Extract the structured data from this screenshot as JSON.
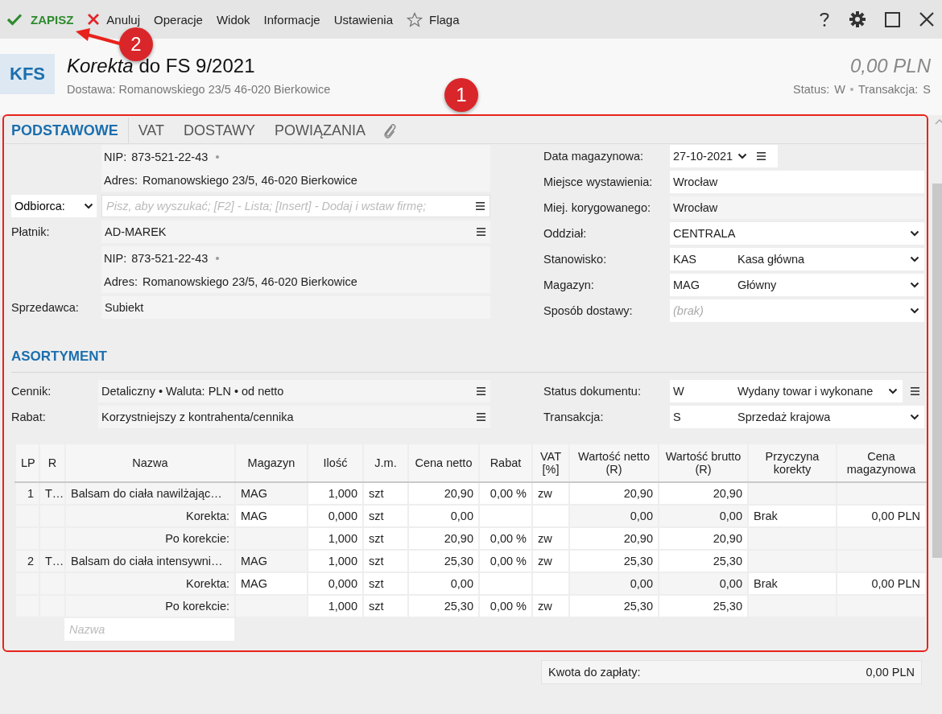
{
  "toolbar": {
    "items": [
      {
        "kind": "save",
        "label": "ZAPISZ"
      },
      {
        "kind": "cancel",
        "label": "Anuluj"
      },
      {
        "kind": "menu",
        "label": "Operacje"
      },
      {
        "kind": "menu",
        "label": "Widok"
      },
      {
        "kind": "menu",
        "label": "Informacje"
      },
      {
        "kind": "menu",
        "label": "Ustawienia"
      },
      {
        "kind": "flag",
        "label": "Flaga"
      }
    ]
  },
  "header": {
    "badge": "KFS",
    "title": "*Korekta* do FS 9/2021",
    "subtitle": "Dostawa: Romanowskiego 23/5 46-020 Bierkowice",
    "amount": "0,00 PLN",
    "status_label": "Status:",
    "status_value": "W",
    "transaction_label": "Transakcja:",
    "transaction_value": "S"
  },
  "tabs": [
    {
      "label": "PODSTAWOWE",
      "selected": true
    },
    {
      "label": "VAT",
      "selected": false
    },
    {
      "label": "DOSTAWY",
      "selected": false
    },
    {
      "label": "POWIĄZANIA",
      "selected": false
    }
  ],
  "left_form": [
    {
      "kind": "info",
      "lines": [
        {
          "label": "NIP:",
          "value": "873-521-22-43",
          "marker": true
        },
        {
          "label": "Adres:",
          "value": "Romanowskiego 23/5, 46-020 Bierkowice",
          "marker": false
        }
      ]
    },
    {
      "kind": "search",
      "label": "Odbiorca:",
      "placeholder": "Pisz, aby wyszukać; [F2] - Lista; [Insert] - Dodaj i wstaw firmę;"
    },
    {
      "kind": "field",
      "label": "Płatnik:",
      "value": "AD-MAREK",
      "menu": true
    },
    {
      "kind": "info",
      "lines": [
        {
          "label": "NIP:",
          "value": "873-521-22-43",
          "marker": true
        },
        {
          "label": "Adres:",
          "value": "Romanowskiego 23/5, 46-020 Bierkowice",
          "marker": false
        }
      ]
    },
    {
      "kind": "field",
      "label": "Sprzedawca:",
      "value": "Subiekt",
      "menu": false
    }
  ],
  "right_form": [
    {
      "kind": "date",
      "label": "Data magazynowa:",
      "value": "27-10-2021"
    },
    {
      "kind": "input",
      "label": "Miejsce wystawienia:",
      "value": "Wrocław"
    },
    {
      "kind": "readonly",
      "label": "Miej. korygowanego:",
      "value": "Wrocław"
    },
    {
      "kind": "select",
      "label": "Oddział:",
      "value": "CENTRALA"
    },
    {
      "kind": "select",
      "label": "Stanowisko:",
      "code": "KAS",
      "value": "Kasa główna"
    },
    {
      "kind": "select",
      "label": "Magazyn:",
      "code": "MAG",
      "value": "Główny"
    },
    {
      "kind": "select",
      "label": "Sposób dostawy:",
      "placeholder": "(brak)"
    }
  ],
  "section_title": "ASORTYMENT",
  "assortment_left": [
    {
      "kind": "field",
      "label": "Cennik:",
      "value": "Detaliczny • Waluta: PLN • od netto",
      "menu": true
    },
    {
      "kind": "field",
      "label": "Rabat:",
      "value": "Korzystniejszy z kontrahenta/cennika",
      "menu": true
    }
  ],
  "assortment_right": [
    {
      "kind": "select",
      "label": "Status dokumentu:",
      "code": "W",
      "value": "Wydany towar i wykonane",
      "menu": true
    },
    {
      "kind": "select",
      "label": "Transakcja:",
      "code": "S",
      "value": "Sprzedaż krajowa",
      "menu": false
    }
  ],
  "table": {
    "columns": [
      "LP",
      "R",
      "Nazwa",
      "Magazyn",
      "Ilość",
      "J.m.",
      "Cena netto",
      "Rabat",
      "VAT [%]",
      "Wartość netto (R)",
      "Wartość brutto (R)",
      "Przyczyna korekty",
      "Cena magazynowa"
    ],
    "rows": [
      {
        "kind": "item",
        "cells": [
          "1",
          "T…",
          "Balsam do ciała nawilżając…",
          "MAG",
          "1,000",
          "szt",
          "20,90",
          "0,00 %",
          "zw",
          "20,90",
          "20,90",
          "",
          ""
        ]
      },
      {
        "kind": "correction",
        "cells": [
          "",
          "",
          "Korekta:",
          "MAG",
          "0,000",
          "szt",
          "0,00",
          "",
          "",
          "0,00",
          "0,00",
          "Brak",
          "0,00 PLN"
        ]
      },
      {
        "kind": "after",
        "cells": [
          "",
          "",
          "Po korekcie:",
          "",
          "1,000",
          "szt",
          "20,90",
          "0,00 %",
          "zw",
          "20,90",
          "20,90",
          "",
          ""
        ]
      },
      {
        "kind": "item",
        "cells": [
          "2",
          "T…",
          "Balsam do ciała intensywni…",
          "MAG",
          "1,000",
          "szt",
          "25,30",
          "0,00 %",
          "zw",
          "25,30",
          "25,30",
          "",
          ""
        ]
      },
      {
        "kind": "correction",
        "cells": [
          "",
          "",
          "Korekta:",
          "MAG",
          "0,000",
          "szt",
          "0,00",
          "",
          "",
          "0,00",
          "0,00",
          "Brak",
          "0,00 PLN"
        ]
      },
      {
        "kind": "after",
        "cells": [
          "",
          "",
          "Po korekcie:",
          "",
          "1,000",
          "szt",
          "25,30",
          "0,00 %",
          "zw",
          "25,30",
          "25,30",
          "",
          ""
        ]
      }
    ],
    "new_row_placeholder": "Nazwa"
  },
  "total": {
    "label": "Kwota do zapłaty:",
    "value": "0,00 PLN"
  },
  "annotations": [
    {
      "label": "1"
    },
    {
      "label": "2"
    }
  ]
}
